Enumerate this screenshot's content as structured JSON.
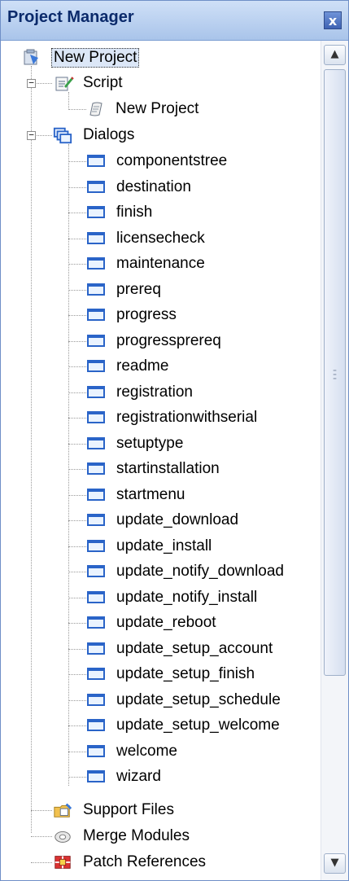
{
  "window": {
    "title": "Project Manager",
    "close_glyph": "x"
  },
  "tree": {
    "root": "New Project",
    "script": {
      "label": "Script",
      "children": [
        "New Project"
      ]
    },
    "dialogs": {
      "label": "Dialogs",
      "children": [
        "componentstree",
        "destination",
        "finish",
        "licensecheck",
        "maintenance",
        "prereq",
        "progress",
        "progressprereq",
        "readme",
        "registration",
        "registrationwithserial",
        "setuptype",
        "startinstallation",
        "startmenu",
        "update_download",
        "update_install",
        "update_notify_download",
        "update_notify_install",
        "update_reboot",
        "update_setup_account",
        "update_setup_finish",
        "update_setup_schedule",
        "update_setup_welcome",
        "welcome",
        "wizard"
      ]
    },
    "support_files": "Support Files",
    "merge_modules": "Merge Modules",
    "patch_references": "Patch References"
  },
  "icons": {
    "root": "project-icon",
    "script": "script-icon",
    "script_child": "scroll-icon",
    "dialogs": "dialogs-icon",
    "dialog_item": "dialog-icon",
    "support_files": "support-files-icon",
    "merge_modules": "merge-modules-icon",
    "patch_references": "patch-references-icon"
  },
  "colors": {
    "title_text": "#0b2a6b",
    "titlebar": "#a9c4ea",
    "dialog_icon": "#2a64c8",
    "root_highlight": "#dce7f7"
  }
}
